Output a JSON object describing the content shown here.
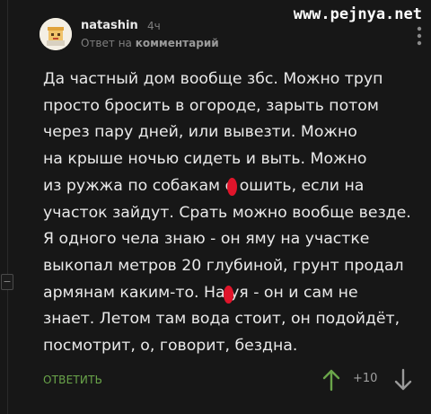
{
  "watermark": "www.pejnya.net",
  "comment": {
    "author": "natashin",
    "time": "4ч",
    "reply_prefix": "Ответ на",
    "reply_target": "комментарий",
    "text": "Да частный дом вообще збс. Можно труп\nпросто бросить в огороде, зарыть потом\nчерез пару дней, или вывезти. Можно\nна крыше ночью сидеть и выть. Можно\nиз ружжа по собакам е ошить, если на\nучасток зайдут. Срать можно вообще везде.\nЯ одного чела знаю - он яму на участке\nвыкопал метров 20 глубиной, грунт продал\nармянам каким-то. На уя - он и сам не\nзнает. Летом там вода стоит, он подойдёт,\nпосмотрит, о, говорит, бездна.",
    "reply_label": "ОТВЕТИТЬ",
    "rating": "+10",
    "censor_color": "#e0152b"
  },
  "colors": {
    "background": "#171717",
    "text": "#e9e9e9",
    "accent": "#6aa54a",
    "muted": "#7f7f7f"
  },
  "icons": {
    "avatar": "cartoon-face-avatar",
    "more": "more-vertical-icon",
    "upvote": "arrow-up-icon",
    "downvote": "arrow-down-icon",
    "collapse": "minus-collapse-icon"
  }
}
